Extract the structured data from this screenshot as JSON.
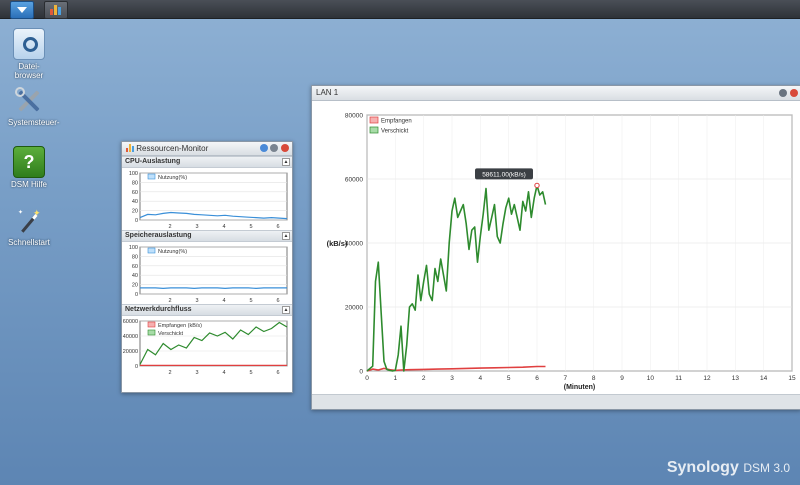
{
  "desktop": {
    "icons": [
      {
        "label": "Datei-\nbrowser",
        "icon": "folder-search-icon"
      },
      {
        "label": "Systemsteuer-",
        "icon": "tools-icon"
      },
      {
        "label": "DSM Hilfe",
        "icon": "help-book-icon"
      },
      {
        "label": "Schnellstart",
        "icon": "magic-wand-icon"
      }
    ],
    "logo_brand": "Synology",
    "logo_product": "DSM 3.0"
  },
  "monitor": {
    "title": "Ressourcen-Monitor",
    "cpu": {
      "title": "CPU-Auslastung",
      "legend": "Nutzung(%)",
      "y_ticks": [
        "100",
        "80",
        "60",
        "40",
        "20",
        "0"
      ],
      "x_ticks": [
        "2",
        "3",
        "4",
        "5",
        "6"
      ],
      "values": [
        5,
        12,
        11,
        14,
        16,
        15,
        14,
        12,
        11,
        10,
        9,
        10,
        8,
        7,
        6,
        5,
        4,
        5,
        4,
        3
      ]
    },
    "mem": {
      "title": "Speicherauslastung",
      "legend": "Nutzung(%)",
      "y_ticks": [
        "100",
        "80",
        "60",
        "40",
        "20",
        "0"
      ],
      "x_ticks": [
        "2",
        "3",
        "4",
        "5",
        "6"
      ],
      "values": [
        13,
        13,
        13,
        12,
        13,
        13,
        13,
        12,
        13,
        13,
        13,
        12,
        13,
        13,
        13,
        12,
        13,
        13,
        13,
        13
      ]
    },
    "net": {
      "title": "Netzwerkdurchfluss",
      "legend_recv": "Empfangen (kB/s)",
      "legend_sent": "Verschickt",
      "y_ticks": [
        "60000",
        "40000",
        "20000",
        "0"
      ],
      "x_ticks": [
        "2",
        "3",
        "4",
        "5",
        "6"
      ],
      "sent": [
        2000,
        22000,
        15000,
        30000,
        22000,
        28000,
        24000,
        38000,
        34000,
        44000,
        40000,
        45000,
        36000,
        48000,
        42000,
        52000,
        46000,
        50000,
        58000,
        52000
      ]
    }
  },
  "lan": {
    "title": "LAN 1",
    "tooltip": "58611.00(kB/s)",
    "ylabel": "(kB/s)",
    "xlabel": "(Minuten)",
    "legend_recv": "Empfangen",
    "legend_sent": "Verschickt"
  },
  "colors": {
    "sent": "#2e8b2e",
    "recv": "#e04040",
    "cpu": "#3a8fd8"
  },
  "chart_data": {
    "type": "line",
    "title": "LAN 1",
    "xlabel": "(Minuten)",
    "ylabel": "(kB/s)",
    "xlim": [
      0,
      15
    ],
    "ylim": [
      0,
      80000
    ],
    "x_ticks": [
      0,
      1,
      2,
      3,
      4,
      5,
      6,
      7,
      8,
      9,
      10,
      11,
      12,
      13,
      14,
      15
    ],
    "y_ticks": [
      0,
      20000,
      40000,
      60000,
      80000
    ],
    "legend": "top-left",
    "series": [
      {
        "name": "Empfangen",
        "x": [
          0,
          0.2,
          0.4,
          0.6,
          0.8,
          1,
          1.2,
          1.5,
          2,
          2.5,
          3,
          3.5,
          4,
          4.5,
          5,
          5.5,
          6,
          6.3
        ],
        "y": [
          0,
          600,
          300,
          800,
          400,
          200,
          300,
          400,
          500,
          600,
          700,
          800,
          900,
          1000,
          1100,
          1200,
          1400,
          1400
        ]
      },
      {
        "name": "Verschickt",
        "x": [
          0,
          0.2,
          0.3,
          0.4,
          0.5,
          0.6,
          0.7,
          0.8,
          0.9,
          1.0,
          1.1,
          1.2,
          1.3,
          1.4,
          1.5,
          1.6,
          1.7,
          1.8,
          1.9,
          2.0,
          2.1,
          2.2,
          2.3,
          2.4,
          2.5,
          2.6,
          2.7,
          2.8,
          2.9,
          3.0,
          3.1,
          3.2,
          3.3,
          3.4,
          3.5,
          3.6,
          3.7,
          3.8,
          3.9,
          4.0,
          4.1,
          4.2,
          4.3,
          4.4,
          4.5,
          4.6,
          4.7,
          4.8,
          4.9,
          5.0,
          5.1,
          5.2,
          5.3,
          5.4,
          5.5,
          5.6,
          5.7,
          5.8,
          5.9,
          6.0,
          6.1,
          6.2,
          6.3
        ],
        "y": [
          0,
          1500,
          28000,
          34000,
          18000,
          3000,
          500,
          200,
          0,
          200,
          5000,
          14000,
          0,
          8000,
          20000,
          21000,
          19000,
          30000,
          22000,
          28000,
          33000,
          24000,
          22000,
          32000,
          28000,
          35000,
          30000,
          25000,
          40000,
          50000,
          54000,
          48000,
          50000,
          52000,
          46000,
          38000,
          44000,
          45000,
          34000,
          42000,
          49000,
          57000,
          44000,
          48000,
          52000,
          42000,
          40000,
          46000,
          51000,
          54000,
          49000,
          52000,
          48000,
          44000,
          53000,
          50000,
          56000,
          48000,
          54000,
          58000,
          55000,
          56000,
          52000
        ]
      }
    ],
    "annotations": [
      "58611.00(kB/s)"
    ]
  }
}
